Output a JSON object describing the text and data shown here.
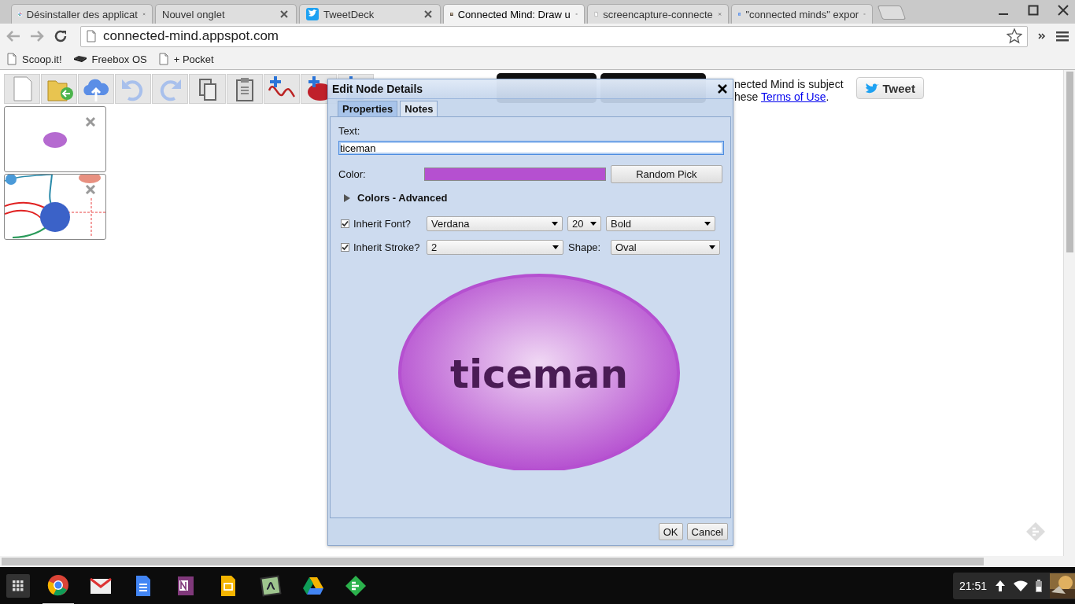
{
  "browser": {
    "tabs": [
      {
        "title": "Désinstaller des applicat",
        "selected": false
      },
      {
        "title": "Nouvel onglet",
        "selected": false
      },
      {
        "title": "TweetDeck",
        "selected": false
      },
      {
        "title": "Connected Mind: Draw u",
        "selected": true
      },
      {
        "title": "screencapture-connecte",
        "selected": false
      },
      {
        "title": "\"connected minds\" expor",
        "selected": false
      }
    ],
    "address": "connected-mind.appspot.com",
    "bookmarks": [
      "Scoop.it!",
      "Freebox OS",
      "+ Pocket"
    ]
  },
  "page": {
    "notice_line1": "nected Mind is subject",
    "notice_line2": "hese ",
    "notice_link": "Terms of Use",
    "notice_end": ".",
    "tweet_button": "Tweet"
  },
  "dialog": {
    "title": "Edit Node Details",
    "tabs": [
      {
        "label": "Properties",
        "selected": true
      },
      {
        "label": "Notes",
        "selected": false
      }
    ],
    "text_label": "Text:",
    "text_value": "ticeman",
    "color_label": "Color:",
    "color": "#b550d0",
    "random_button": "Random Pick",
    "advanced": {
      "label": "Colors - Advanced",
      "expanded": false
    },
    "inherit_font": {
      "label": "Inherit Font?",
      "checked": true,
      "font": "Verdana",
      "size": "20",
      "weight": "Bold"
    },
    "inherit_stroke": {
      "label": "Inherit Stroke?",
      "checked": true,
      "stroke": "2"
    },
    "shape_label": "Shape:",
    "shape": "Oval",
    "preview_text": "ticeman",
    "buttons": [
      "OK",
      "Cancel"
    ]
  },
  "shelf": {
    "time": "21:51"
  }
}
